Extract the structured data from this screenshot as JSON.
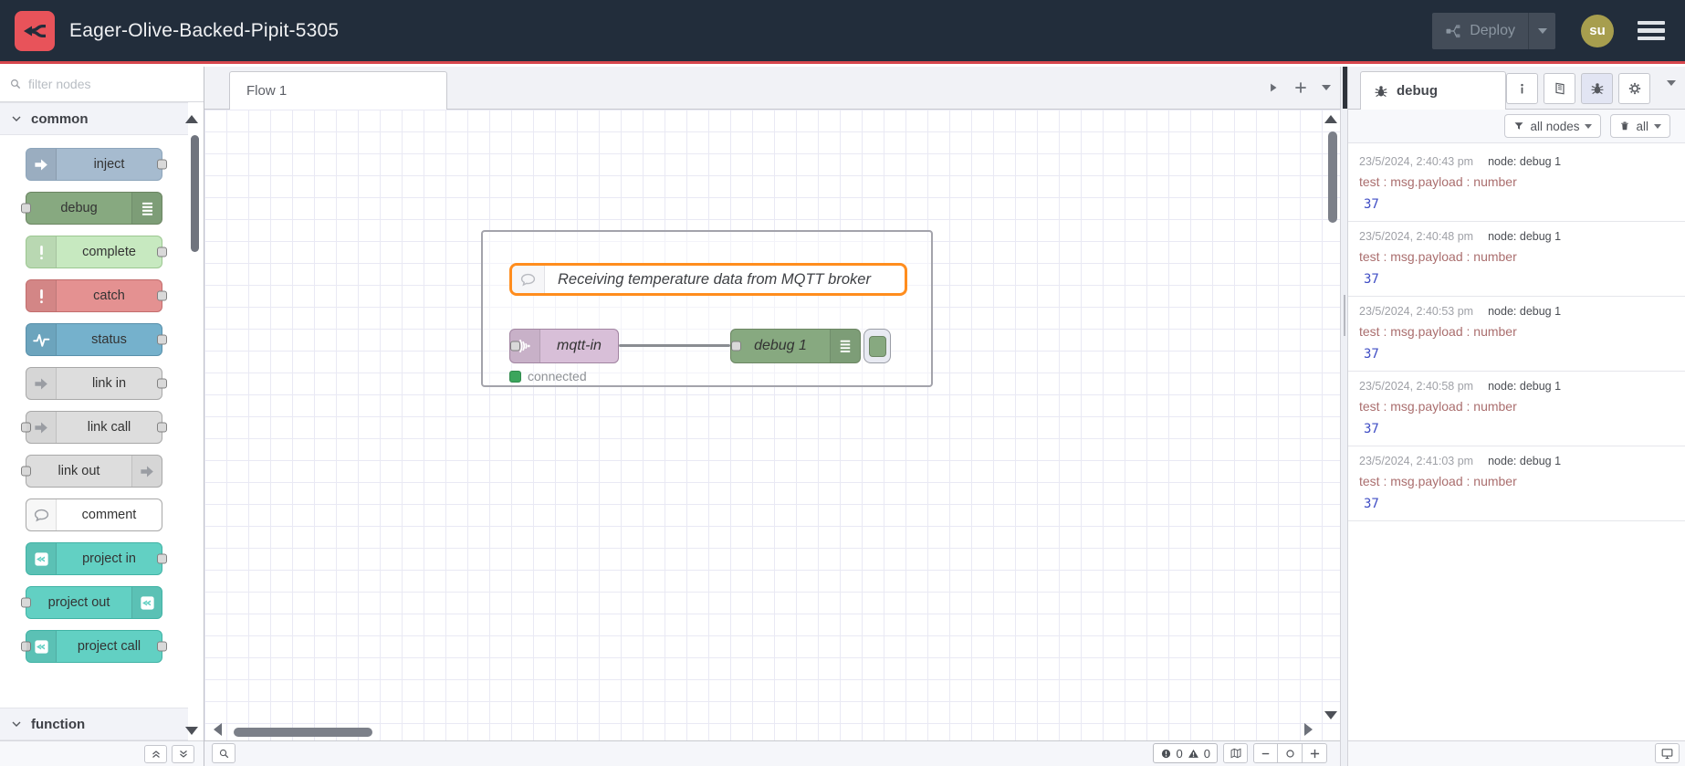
{
  "colors": {
    "header_bg": "#222d3b",
    "header_red": "#d6464d",
    "logo_red": "#e8535a",
    "deploy_bg": "#434c58",
    "deploy_text": "#8b96a1",
    "avatar_bg": "#a79e4e",
    "canvas_grid": "#e9e9f4",
    "group_border": "#a3a3ab",
    "comment_selected": "#ff8d1e",
    "node_mqtt": "#d8bfd8",
    "node_mqtt_border": "#a184a1",
    "node_debug": "#87a980",
    "node_debug_border": "#6b8562",
    "wire": "#8a8d92",
    "port_fill": "#d9d9d9",
    "port_border": "#808080",
    "status_green": "#3ba55c",
    "debug_meta": "#aa6e6e",
    "debug_value": "#3e4cc4"
  },
  "header": {
    "title": "Eager-Olive-Backed-Pipit-5305",
    "deploy_label": "Deploy",
    "user_initials": "su"
  },
  "palette": {
    "search_placeholder": "filter nodes",
    "categories": {
      "common": "common",
      "function": "function"
    },
    "nodes": [
      {
        "label": "inject",
        "color": "#a6bbcf",
        "border": "#8da5bb",
        "icon": "arrow-in-icon",
        "layout": "icon-left port-right"
      },
      {
        "label": "debug",
        "color": "#87a980",
        "border": "#6b8562",
        "icon": "list-icon",
        "layout": "icon-right port-left"
      },
      {
        "label": "complete",
        "color": "#c7e9c0",
        "border": "#9cc791",
        "icon": "exclamation-icon",
        "layout": "icon-left port-right"
      },
      {
        "label": "catch",
        "color": "#e49191",
        "border": "#c26d6d",
        "icon": "exclamation-icon",
        "layout": "icon-left port-right"
      },
      {
        "label": "status",
        "color": "#75b1cc",
        "border": "#5890ab",
        "icon": "pulse-icon",
        "layout": "icon-left port-right"
      },
      {
        "label": "link in",
        "color": "#dddddd",
        "border": "#a8a8a8",
        "icon": "link-arrow-icon",
        "layout": "icon-left port-right gray-icon"
      },
      {
        "label": "link call",
        "color": "#dddddd",
        "border": "#a8a8a8",
        "icon": "link-arrow-icon",
        "layout": "icon-left port-both gray-icon"
      },
      {
        "label": "link out",
        "color": "#dddddd",
        "border": "#a8a8a8",
        "icon": "link-arrow-icon",
        "layout": "icon-right port-left gray-icon"
      },
      {
        "label": "comment",
        "color": "#ffffff",
        "border": "#a8a8a8",
        "icon": "comment-bubble-icon",
        "layout": "icon-left gray-icon"
      },
      {
        "label": "project in",
        "color": "#62d0c3",
        "border": "#41b3a5",
        "icon": "node-red-logo-icon",
        "layout": "icon-left port-right"
      },
      {
        "label": "project out",
        "color": "#62d0c3",
        "border": "#41b3a5",
        "icon": "node-red-logo-icon",
        "layout": "icon-right port-left"
      },
      {
        "label": "project call",
        "color": "#62d0c3",
        "border": "#41b3a5",
        "icon": "node-red-logo-icon",
        "layout": "icon-left port-both"
      }
    ]
  },
  "canvas": {
    "tab_label": "Flow 1",
    "group": {
      "comment_text": "Receiving temperature data from MQTT broker",
      "mqtt_label": "mqtt-in",
      "debug_label": "debug 1",
      "status_text": "connected"
    },
    "footer": {
      "error_count": "0",
      "warning_count": "0"
    }
  },
  "debug_panel": {
    "tab_label": "debug",
    "filter_label": "all nodes",
    "clear_label": "all",
    "messages": [
      {
        "timestamp": "23/5/2024, 2:40:43 pm",
        "source": "node: debug 1",
        "path": "test : msg.payload : number",
        "value": "37"
      },
      {
        "timestamp": "23/5/2024, 2:40:48 pm",
        "source": "node: debug 1",
        "path": "test : msg.payload : number",
        "value": "37"
      },
      {
        "timestamp": "23/5/2024, 2:40:53 pm",
        "source": "node: debug 1",
        "path": "test : msg.payload : number",
        "value": "37"
      },
      {
        "timestamp": "23/5/2024, 2:40:58 pm",
        "source": "node: debug 1",
        "path": "test : msg.payload : number",
        "value": "37"
      },
      {
        "timestamp": "23/5/2024, 2:41:03 pm",
        "source": "node: debug 1",
        "path": "test : msg.payload : number",
        "value": "37"
      }
    ]
  }
}
